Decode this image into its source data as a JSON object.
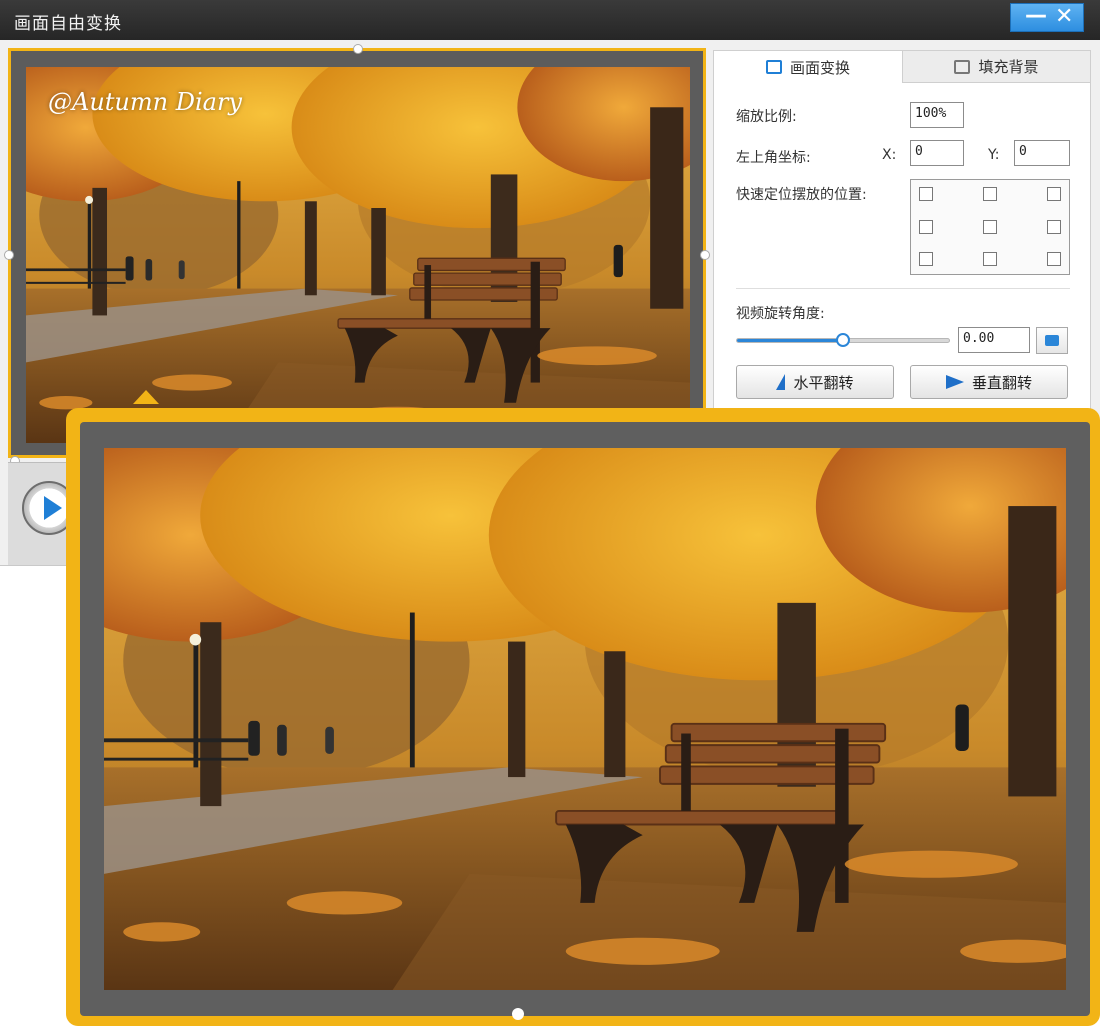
{
  "window": {
    "title": "画面自由变换",
    "minimize_glyph": "—",
    "close_glyph": "✕"
  },
  "preview": {
    "watermark": "@Autumn Diary"
  },
  "tabs": [
    {
      "label": "画面变换",
      "icon": "transform-icon",
      "active": true
    },
    {
      "label": "填充背景",
      "icon": "fill-background-icon",
      "active": false
    }
  ],
  "transform": {
    "scale_label": "缩放比例:",
    "scale_value": "100%",
    "origin_label": "左上角坐标:",
    "x_label": "X:",
    "x_value": "0",
    "y_label": "Y:",
    "y_value": "0",
    "quick_position_label": "快速定位摆放的位置:",
    "rotation_label": "视频旋转角度:",
    "rotation_value": "0.00",
    "rotation_slider_fraction": 0.5,
    "flip_horizontal_label": "水平翻转",
    "flip_vertical_label": "垂直翻转"
  },
  "colors": {
    "accent_frame": "#f2b416",
    "accent_blue": "#2b86d8",
    "titlebar": "#2e2e2e"
  }
}
